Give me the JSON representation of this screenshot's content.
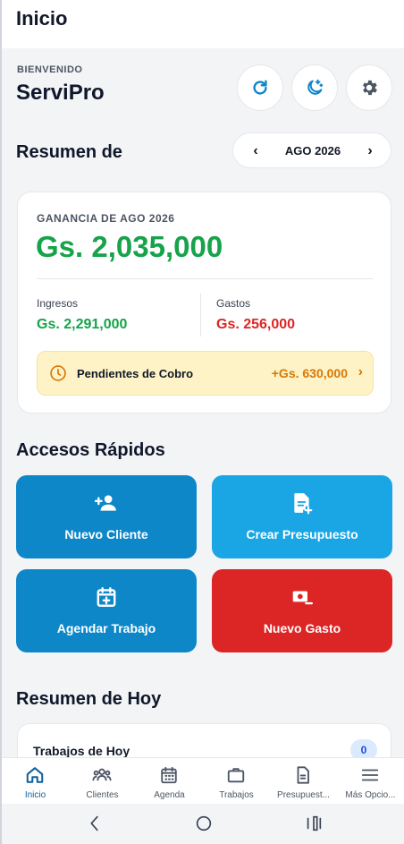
{
  "appbar": {
    "title": "Inicio"
  },
  "welcome": {
    "label": "BIENVENIDO",
    "name": "ServiPro"
  },
  "header_actions": [
    {
      "icon": "refresh-icon"
    },
    {
      "icon": "moon-stars-icon"
    },
    {
      "icon": "gear-icon"
    }
  ],
  "summary": {
    "title": "Resumen de",
    "month_label": "AGO 2026",
    "prev": "‹",
    "next": "›",
    "profit_label": "GANANCIA DE AGO 2026",
    "profit_value": "Gs. 2,035,000",
    "income_label": "Ingresos",
    "income_value": "Gs. 2,291,000",
    "expenses_label": "Gastos",
    "expenses_value": "Gs. 256,000",
    "pending_label": "Pendientes de Cobro",
    "pending_value": "+Gs. 630,000",
    "pending_chevron": "›"
  },
  "quick": {
    "title": "Accesos Rápidos",
    "buttons": [
      {
        "label": "Nuevo Cliente",
        "icon": "add-user-icon",
        "color": "#0e87c8"
      },
      {
        "label": "Crear Presupuesto",
        "icon": "add-document-icon",
        "color": "#1aa6e4"
      },
      {
        "label": "Agendar Trabajo",
        "icon": "calendar-add-icon",
        "color": "#0e87c8"
      },
      {
        "label": "Nuevo Gasto",
        "icon": "money-minus-icon",
        "color": "#dc2626"
      }
    ]
  },
  "today": {
    "title": "Resumen de Hoy",
    "jobs_label": "Trabajos de Hoy",
    "jobs_count": "0"
  },
  "nav": {
    "items": [
      {
        "label": "Inicio",
        "icon": "home-icon",
        "active": true
      },
      {
        "label": "Clientes",
        "icon": "users-icon"
      },
      {
        "label": "Agenda",
        "icon": "calendar-icon"
      },
      {
        "label": "Trabajos",
        "icon": "briefcase-icon"
      },
      {
        "label": "Presupuest...",
        "icon": "document-icon"
      },
      {
        "label": "Más Opcio...",
        "icon": "menu-icon"
      }
    ]
  },
  "colors": {
    "primary": "#0e87c8",
    "success": "#16a34a",
    "danger": "#dc2626",
    "warning": "#d97706"
  }
}
